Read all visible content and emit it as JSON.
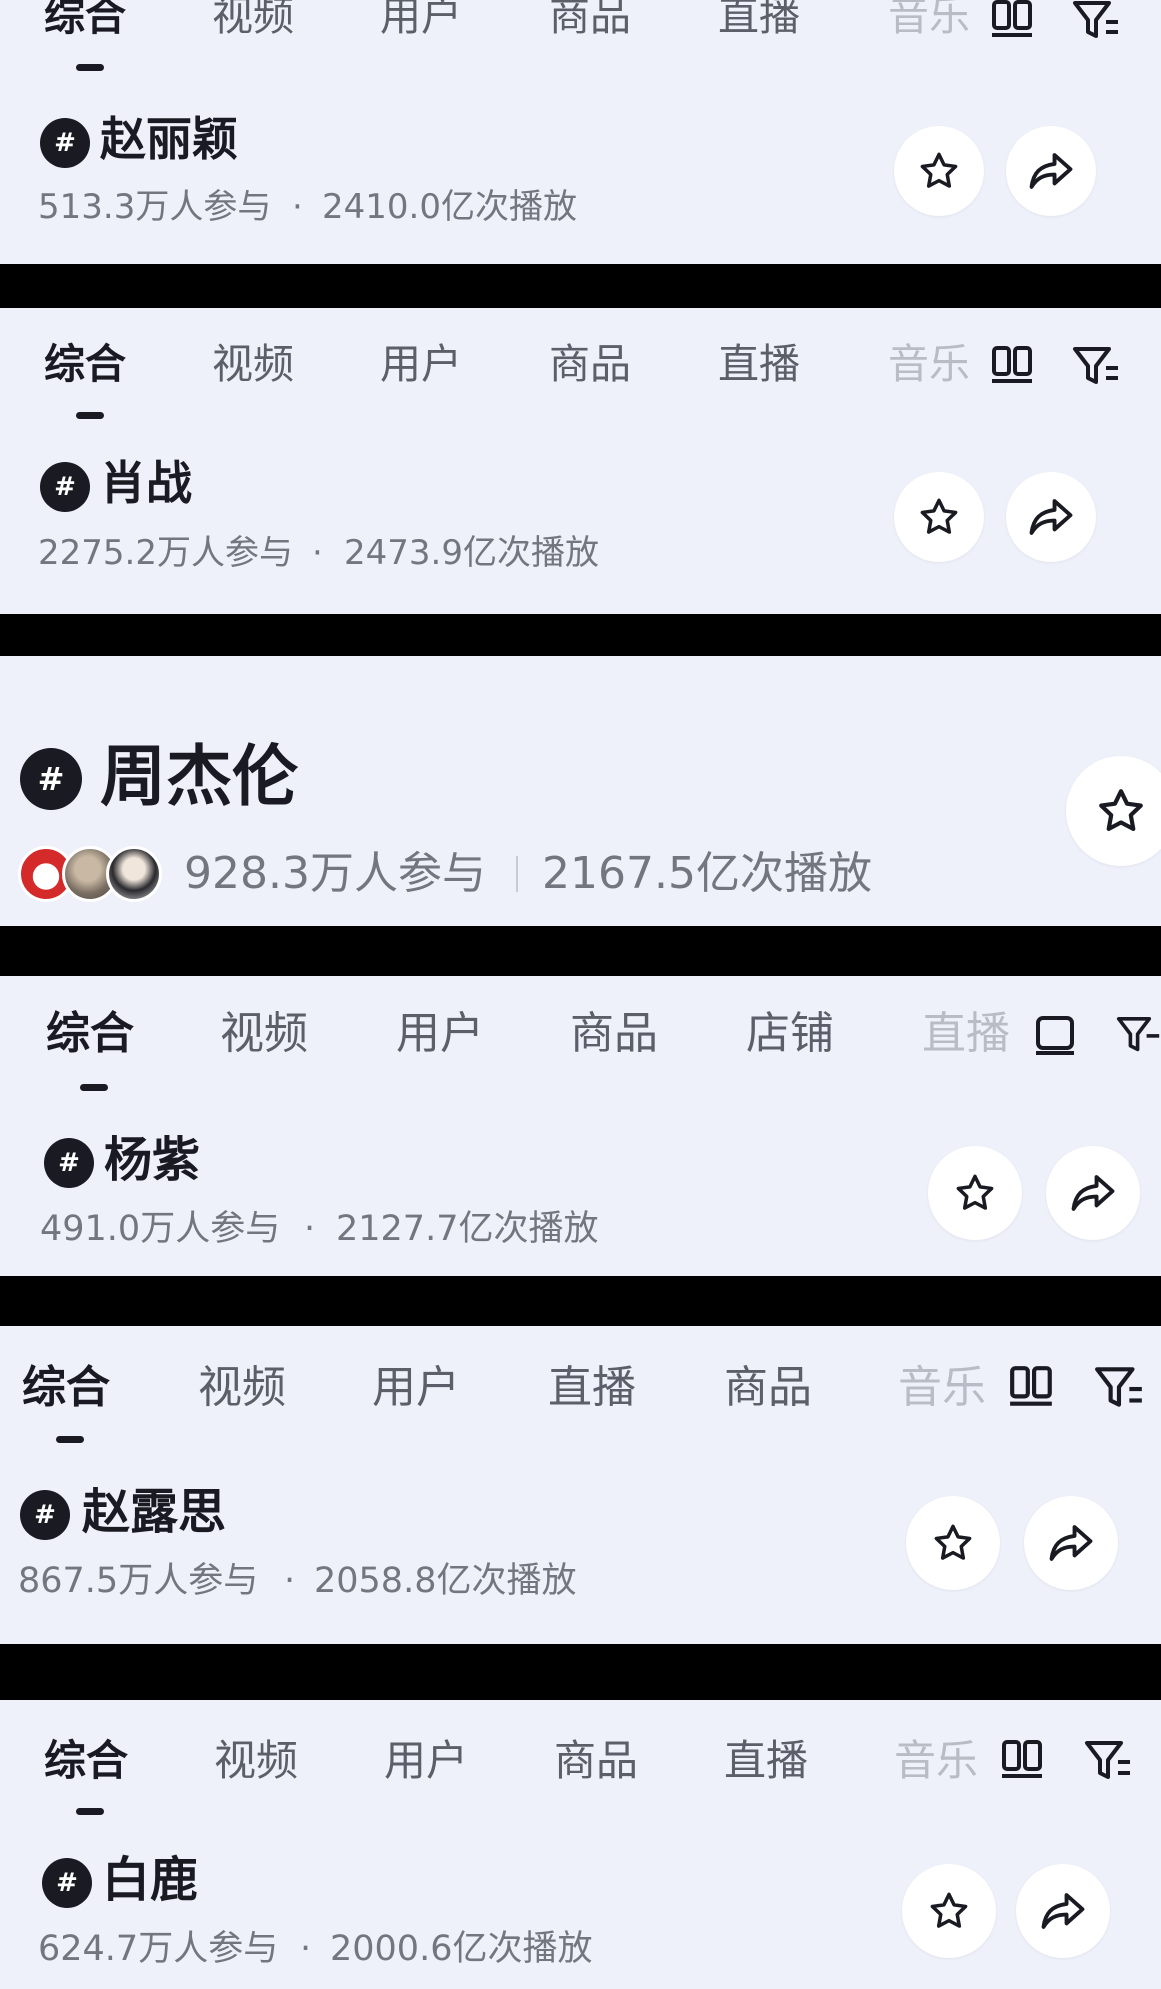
{
  "sections": [
    {
      "tabs": [
        "综合",
        "视频",
        "用户",
        "商品",
        "直播",
        "音乐"
      ],
      "topic": "赵丽颖",
      "participants": "513.3万人参与",
      "plays": "2410.0亿次播放"
    },
    {
      "tabs": [
        "综合",
        "视频",
        "用户",
        "商品",
        "直播",
        "音乐"
      ],
      "topic": "肖战",
      "participants": "2275.2万人参与",
      "plays": "2473.9亿次播放"
    },
    {
      "topic": "周杰伦",
      "participants": "928.3万人参与",
      "plays": "2167.5亿次播放"
    },
    {
      "tabs": [
        "综合",
        "视频",
        "用户",
        "商品",
        "店铺",
        "直播"
      ],
      "topic": "杨紫",
      "participants": "491.0万人参与",
      "plays": "2127.7亿次播放"
    },
    {
      "tabs": [
        "综合",
        "视频",
        "用户",
        "直播",
        "商品",
        "音乐"
      ],
      "topic": "赵露思",
      "participants": "867.5万人参与",
      "plays": "2058.8亿次播放"
    },
    {
      "tabs": [
        "综合",
        "视频",
        "用户",
        "商品",
        "直播",
        "音乐"
      ],
      "topic": "白鹿",
      "participants": "624.7万人参与",
      "plays": "2000.6亿次播放"
    }
  ],
  "separator": "·",
  "icons": [
    "hashtag-icon",
    "star-icon",
    "share-icon",
    "grid-toggle-icon",
    "filter-icon"
  ],
  "colors": {
    "background": "#eef1fa",
    "text": "#1a1b22",
    "muted": "#74767f",
    "divider_band": "#000000"
  }
}
